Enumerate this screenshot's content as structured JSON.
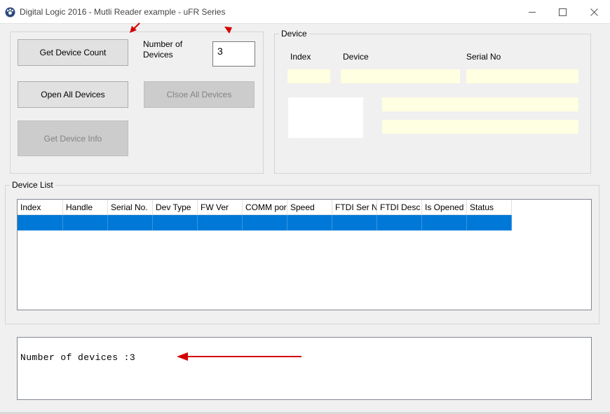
{
  "window": {
    "title": "Digital Logic 2016 - Mutli Reader example - uFR Series"
  },
  "top_panel": {
    "get_count_label": "Get Device Count",
    "count_label": "Number of Devices",
    "count_value": "3",
    "open_all_label": "Open All Devices",
    "close_all_label": "Clsoe All Devices",
    "get_info_label": "Get Device Info"
  },
  "device_group": {
    "title": "Device",
    "index_label": "Index",
    "device_label": "Device",
    "serial_label": "Serial No"
  },
  "device_list": {
    "title": "Device List",
    "columns": [
      "Index",
      "Handle",
      "Serial No.",
      "Dev Type",
      "FW Ver",
      "COMM port",
      "Speed",
      "FTDI Ser No",
      "FTDI Desc",
      "Is Opened",
      "Status"
    ]
  },
  "console": {
    "text": "Number of devices :3"
  },
  "colors": {
    "selection": "#0078d7",
    "field_bg": "#ffffe1",
    "annotation_arrow": "#d40000"
  }
}
